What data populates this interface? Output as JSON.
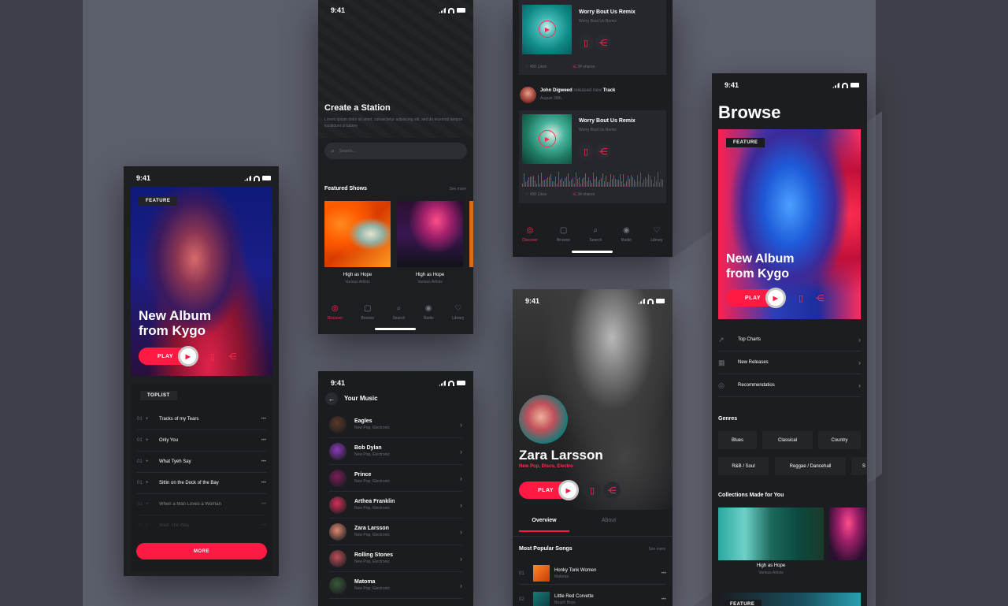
{
  "status": {
    "time": "9:41"
  },
  "phone1": {
    "feature_tag": "FEATURE",
    "album_title_1": "New Album",
    "album_title_2": "from Kygo",
    "play_label": "PLAY",
    "toplist_tag": "TOPLIST",
    "tracks": [
      {
        "num": "01",
        "title": "Tracks of my Tears"
      },
      {
        "num": "01",
        "title": "Only You"
      },
      {
        "num": "01",
        "title": "What Tyeh Say"
      },
      {
        "num": "01",
        "title": "Sittin on the Dock of the Bay"
      },
      {
        "num": "01",
        "title": "When a Man Loves a Woman"
      },
      {
        "num": "01",
        "title": "Walk The Way"
      }
    ],
    "more_label": "MORE"
  },
  "phone2": {
    "title": "Create a Station",
    "desc": "Lorem ipsum dolor sit amet, consectetur adipiscing elit, sed do eiusmod tempor incididunt ut labore",
    "search_placeholder": "Search...",
    "section": "Featured Shows",
    "see_more": "See more",
    "shows": [
      {
        "title": "High as Hope",
        "artist": "Various Artists"
      },
      {
        "title": "High as Hope",
        "artist": "Various Artists"
      }
    ],
    "nav": [
      "Discover",
      "Browse",
      "Search",
      "Radio",
      "Library"
    ]
  },
  "phone3": {
    "title": "Your Music",
    "artists": [
      {
        "name": "Eagles",
        "genre": "New Pop, Electronic"
      },
      {
        "name": "Bob Dylan",
        "genre": "New Pop, Electronic"
      },
      {
        "name": "Prince",
        "genre": "New Pop, Electronic"
      },
      {
        "name": "Arthea Franklin",
        "genre": "New Pop, Electronic"
      },
      {
        "name": "Zara Larsson",
        "genre": "New Pop, Electronic"
      },
      {
        "name": "Rolling Stones",
        "genre": "New Pop, Electronic"
      },
      {
        "name": "Matoma",
        "genre": "New Pop, Electronic"
      }
    ]
  },
  "phone4": {
    "card1": {
      "title": "Worry Bout Us Remix",
      "sub": "Worry Bout Us Remix",
      "likes": "450 Likes",
      "shares": "34 shares"
    },
    "activity": {
      "user": "John Digweed",
      "action": "released new",
      "object": "Track",
      "date": "August 28th"
    },
    "card2": {
      "title": "Worry Bout Us Remix",
      "sub": "Worry Bout Us Remix",
      "likes": "450 Likes",
      "shares": "34 shares"
    },
    "nav": [
      "Discover",
      "Browse",
      "Search",
      "Radio",
      "Library"
    ]
  },
  "phone5": {
    "artist": "Zara Larsson",
    "genres": "New Pop, Disco, Electro",
    "play_label": "PLAY",
    "tabs": [
      "Overview",
      "About"
    ],
    "section": "Most Popular Songs",
    "see_more": "See more",
    "songs": [
      {
        "num": "01",
        "title": "Honky Tonk Women",
        "artist": "Matoma"
      },
      {
        "num": "02",
        "title": "Little Red Corvette",
        "artist": "Beach Boys"
      }
    ]
  },
  "phone6": {
    "title": "Browse",
    "feature_tag": "FEATURE",
    "album_title_1": "New Album",
    "album_title_2": "from Kygo",
    "play_label": "PLAY",
    "menu": [
      "Top Charts",
      "New Releases",
      "Recommendatios"
    ],
    "genres_title": "Genres",
    "genres": [
      "Blues",
      "Classical",
      "Country",
      "R&B / Soul",
      "Reggae / Dancehall",
      "S"
    ],
    "collections_title": "Collections Made for You",
    "collection": {
      "title": "High as Hope",
      "artist": "Various Artists"
    },
    "feature_tag_2": "FEATURE"
  }
}
